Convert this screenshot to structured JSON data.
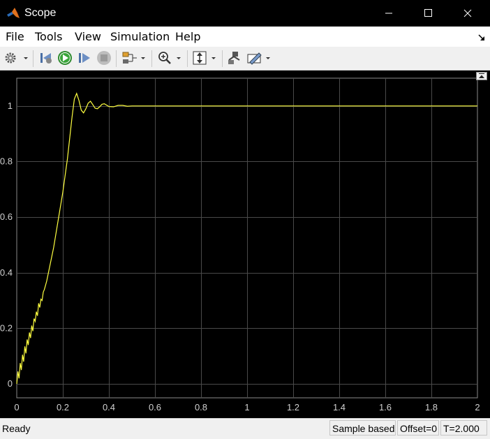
{
  "window": {
    "title": "Scope",
    "controls": [
      "minimize",
      "maximize",
      "close"
    ]
  },
  "menu": {
    "items": [
      "File",
      "Tools",
      "View",
      "Simulation",
      "Help"
    ]
  },
  "toolbar": {
    "buttons": [
      {
        "icon": "settings-gear-icon",
        "dropdown": true
      },
      {
        "icon": "step-back-icon"
      },
      {
        "icon": "run-icon"
      },
      {
        "icon": "step-forward-icon"
      },
      {
        "icon": "stop-icon",
        "disabled": true
      },
      {
        "icon": "signal-selector-icon",
        "dropdown": true
      },
      {
        "icon": "zoom-in-icon",
        "dropdown": true
      },
      {
        "icon": "scale-axes-icon",
        "dropdown": true
      },
      {
        "icon": "highlight-block-icon"
      },
      {
        "icon": "measurements-icon",
        "dropdown": true
      }
    ]
  },
  "chart_data": {
    "type": "line",
    "title": "",
    "xlabel": "",
    "ylabel": "",
    "xlim": [
      0,
      2
    ],
    "ylim": [
      -0.05,
      1.1
    ],
    "xticks": [
      "0",
      "0.2",
      "0.4",
      "0.6",
      "0.8",
      "1",
      "1.2",
      "1.4",
      "1.6",
      "1.8",
      "2"
    ],
    "yticks": [
      "0",
      "0.2",
      "0.4",
      "0.6",
      "0.8",
      "1"
    ],
    "grid": true,
    "background": "#000000",
    "line_color": "#ffff40",
    "series": [
      {
        "x": [
          0,
          0.005,
          0.01,
          0.015,
          0.02,
          0.025,
          0.03,
          0.035,
          0.04,
          0.045,
          0.05,
          0.055,
          0.06,
          0.065,
          0.07,
          0.075,
          0.08,
          0.085,
          0.09,
          0.095,
          0.1,
          0.105,
          0.11,
          0.115,
          0.12,
          0.13,
          0.14,
          0.15,
          0.16,
          0.18,
          0.2,
          0.22,
          0.24,
          0.25,
          0.26,
          0.27,
          0.28,
          0.29,
          0.3,
          0.31,
          0.32,
          0.33,
          0.34,
          0.35,
          0.36,
          0.37,
          0.38,
          0.39,
          0.4,
          0.42,
          0.44,
          0.46,
          0.48,
          0.5,
          0.55,
          0.6,
          0.7,
          0.8,
          1.0,
          1.5,
          2.0
        ],
        "y": [
          0,
          0.045,
          0.02,
          0.075,
          0.05,
          0.105,
          0.08,
          0.135,
          0.11,
          0.16,
          0.14,
          0.185,
          0.165,
          0.21,
          0.19,
          0.235,
          0.225,
          0.26,
          0.245,
          0.29,
          0.275,
          0.305,
          0.3,
          0.33,
          0.34,
          0.37,
          0.41,
          0.45,
          0.49,
          0.59,
          0.69,
          0.81,
          0.96,
          1.025,
          1.045,
          1.02,
          0.985,
          0.975,
          0.99,
          1.01,
          1.017,
          1.005,
          0.992,
          0.99,
          0.997,
          1.006,
          1.008,
          1.003,
          0.998,
          0.997,
          1.002,
          1.002,
          0.999,
          1.0,
          1.0,
          1.0,
          1.0,
          1.0,
          1.0,
          1.0,
          1.0
        ]
      }
    ]
  },
  "status": {
    "ready": "Ready",
    "mode": "Sample based",
    "offset": "Offset=0",
    "time": "T=2.000"
  }
}
